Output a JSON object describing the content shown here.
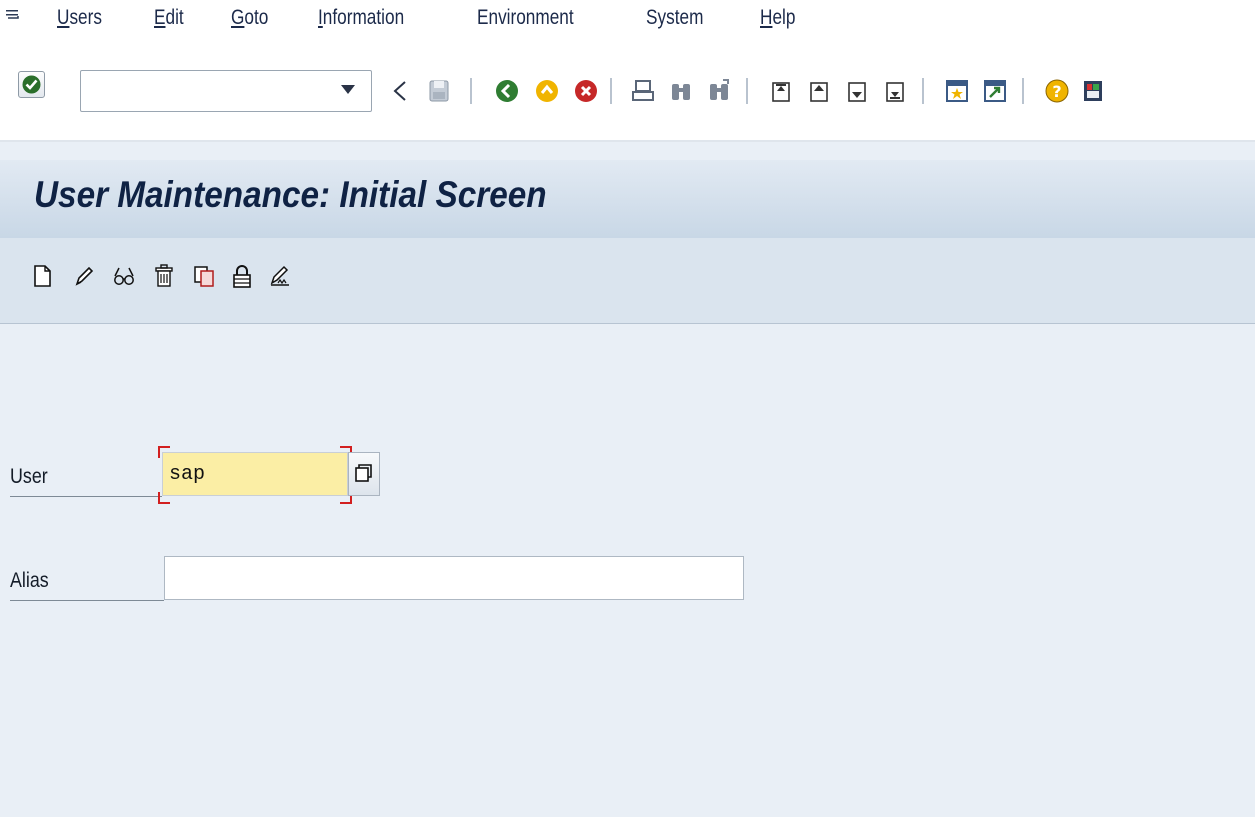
{
  "menu": {
    "items": [
      {
        "mnemonic": "U",
        "rest": "sers"
      },
      {
        "mnemonic": "E",
        "rest": "dit"
      },
      {
        "mnemonic": "G",
        "rest": "oto"
      },
      {
        "mnemonic": "I",
        "rest": "nformation"
      },
      {
        "mnemonic": "",
        "rest": "Environment"
      },
      {
        "mnemonic": "",
        "rest": "System"
      },
      {
        "mnemonic": "H",
        "rest": "elp"
      }
    ]
  },
  "command_field": {
    "value": "",
    "icon": "chevron-down-icon"
  },
  "standard_toolbar_icons": [
    "enter-icon",
    "back-triangle-icon",
    "save-icon",
    "back-icon",
    "exit-icon",
    "cancel-icon",
    "print-icon",
    "find-icon",
    "find-next-icon",
    "first-page-icon",
    "previous-page-icon",
    "next-page-icon",
    "last-page-icon",
    "create-session-icon",
    "shortcut-icon",
    "help-icon",
    "customize-layout-icon"
  ],
  "title": "User Maintenance: Initial Screen",
  "app_toolbar_icons": [
    "create-icon",
    "change-icon",
    "display-icon",
    "delete-icon",
    "copy-icon",
    "lock-icon",
    "change-password-icon"
  ],
  "form": {
    "user_label": "User",
    "user_value": "sap",
    "alias_label": "Alias",
    "alias_value": ""
  },
  "colors": {
    "background": "#e9eff6",
    "required_field": "#fbeea5",
    "required_marker": "#d21f1f"
  }
}
